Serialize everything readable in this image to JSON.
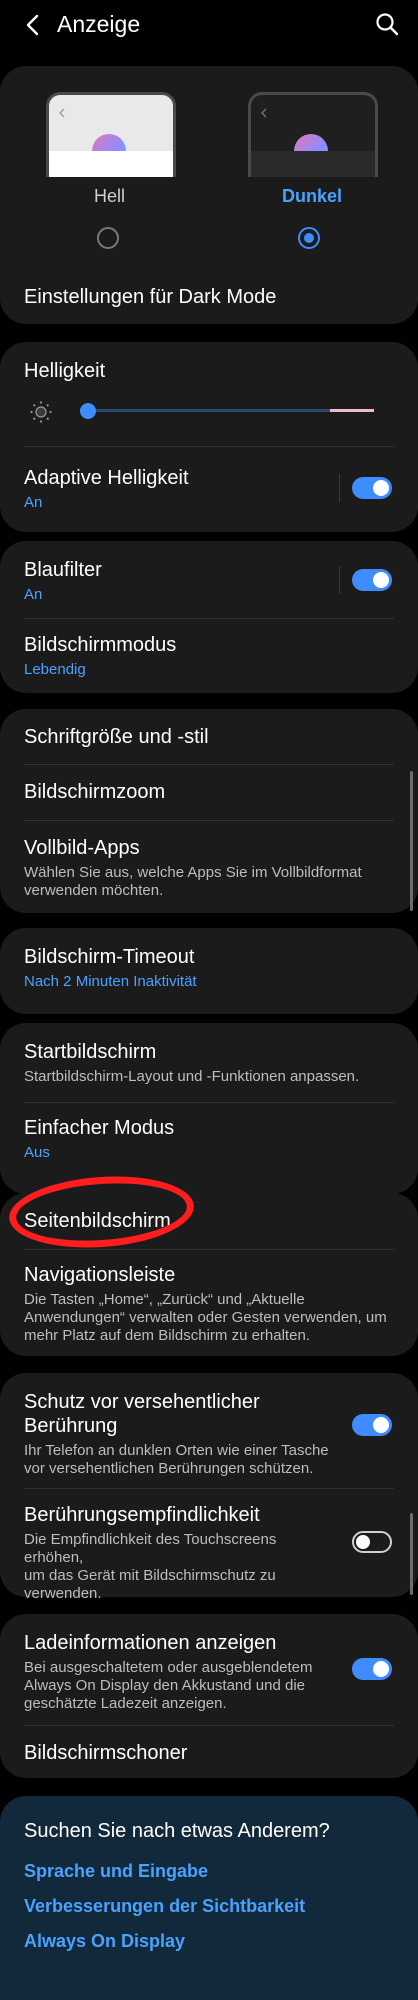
{
  "header": {
    "title": "Anzeige"
  },
  "theme": {
    "light_label": "Hell",
    "dark_label": "Dunkel",
    "selected": "dark",
    "dark_mode_settings": "Einstellungen für Dark Mode"
  },
  "brightness": {
    "label": "Helligkeit",
    "level": 0.03,
    "adaptive_label": "Adaptive Helligkeit",
    "adaptive_status": "An",
    "adaptive_on": true
  },
  "bluefilter": {
    "label": "Blaufilter",
    "status": "An",
    "on": true
  },
  "screenmode": {
    "label": "Bildschirmmodus",
    "status": "Lebendig"
  },
  "group3": {
    "font": "Schriftgröße und -stil",
    "zoom": "Bildschirmzoom",
    "fullscreen_label": "Vollbild-Apps",
    "fullscreen_desc1": "Wählen Sie aus, welche Apps Sie im Vollbildformat",
    "fullscreen_desc2": "verwenden möchten."
  },
  "timeout": {
    "label": "Bildschirm-Timeout",
    "status": "Nach 2 Minuten Inaktivität"
  },
  "home": {
    "label": "Startbildschirm",
    "desc": "Startbildschirm-Layout und -Funktionen anpassen.",
    "easy_label": "Einfacher Modus",
    "easy_status": "Aus"
  },
  "edge": {
    "label": "Seitenbildschirm",
    "nav_label": "Navigationsleiste",
    "nav_desc1": "Die Tasten „Home“, „Zurück“ und „Aktuelle",
    "nav_desc2": "Anwendungen“ verwalten oder Gesten verwenden, um",
    "nav_desc3": "mehr Platz auf dem Bildschirm zu erhalten."
  },
  "protect": {
    "label1": "Schutz vor versehentlicher",
    "label2": "Berührung",
    "desc1": "Ihr Telefon an dunklen Orten wie einer Tasche",
    "desc2": "vor versehentlichen Berührungen schützen.",
    "on": true,
    "sens_label": "Berührungsempfindlichkeit",
    "sens_desc1": "Die Empfindlichkeit des Touchscreens erhöhen,",
    "sens_desc2": "um das Gerät mit Bildschirmschutz zu",
    "sens_desc3": "verwenden.",
    "sens_on": false
  },
  "charge": {
    "label": "Ladeinformationen anzeigen",
    "desc1": "Bei ausgeschaltetem oder ausgeblendetem",
    "desc2": "Always On Display den Akkustand und die",
    "desc3": "geschätzte Ladezeit anzeigen.",
    "on": true,
    "screensaver": "Bildschirmschoner"
  },
  "suggestions": {
    "title": "Suchen Sie nach etwas Anderem?",
    "link1": "Sprache und Eingabe",
    "link2": "Verbesserungen der Sichtbarkeit",
    "link3": "Always On Display"
  },
  "colors": {
    "accent": "#3f8cff",
    "link": "#4aa2ff",
    "annotation": "#ff1d1d"
  },
  "icons": [
    "back-arrow-icon",
    "search-icon",
    "brightness-sun-icon"
  ]
}
